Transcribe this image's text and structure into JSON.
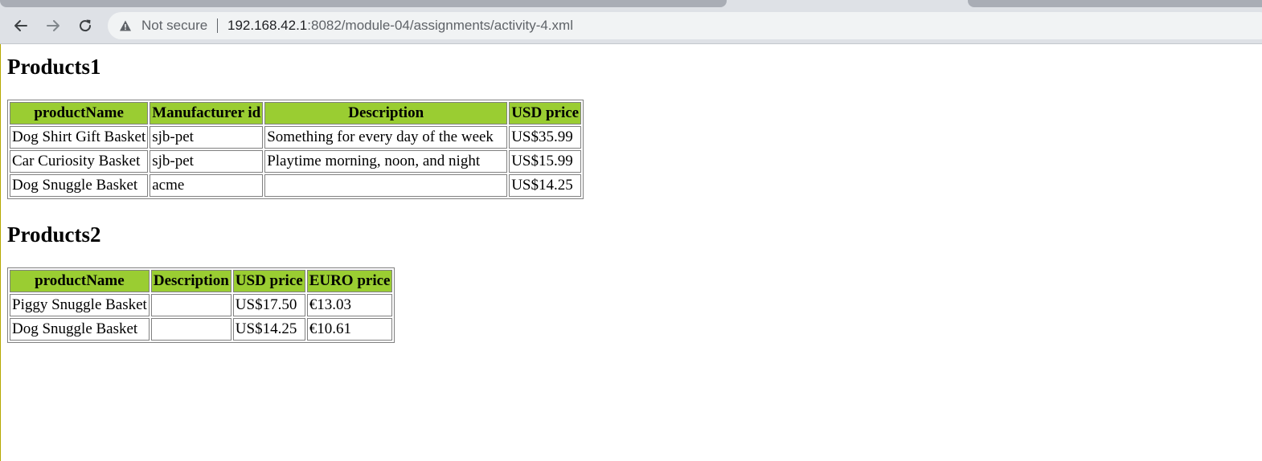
{
  "browser": {
    "security_label": "Not secure",
    "url_host": "192.168.42.1",
    "url_rest": ":8082/module-04/assignments/activity-4.xml"
  },
  "products1": {
    "title": "Products1",
    "headers": [
      "productName",
      "Manufacturer id",
      "Description",
      "USD price"
    ],
    "rows": [
      [
        "Dog Shirt Gift Basket",
        "sjb-pet",
        "Something for every day of the week",
        "US$35.99"
      ],
      [
        "Car Curiosity Basket",
        "sjb-pet",
        "Playtime morning, noon, and night",
        "US$15.99"
      ],
      [
        "Dog Snuggle Basket",
        "acme",
        "",
        "US$14.25"
      ]
    ]
  },
  "products2": {
    "title": "Products2",
    "headers": [
      "productName",
      "Description",
      "USD price",
      "EURO price"
    ],
    "rows": [
      [
        "Piggy Snuggle Basket",
        "",
        "US$17.50",
        "€13.03"
      ],
      [
        "Dog Snuggle Basket",
        "",
        "US$14.25",
        "€10.61"
      ]
    ]
  },
  "colors": {
    "header_bg": "#9acd32",
    "chrome_bg": "#dee1e6",
    "omnibox_bg": "#f1f3f4"
  },
  "icons": {
    "back": "arrow-left-icon",
    "forward": "arrow-right-icon",
    "reload": "reload-icon",
    "security": "warning-triangle-icon"
  }
}
